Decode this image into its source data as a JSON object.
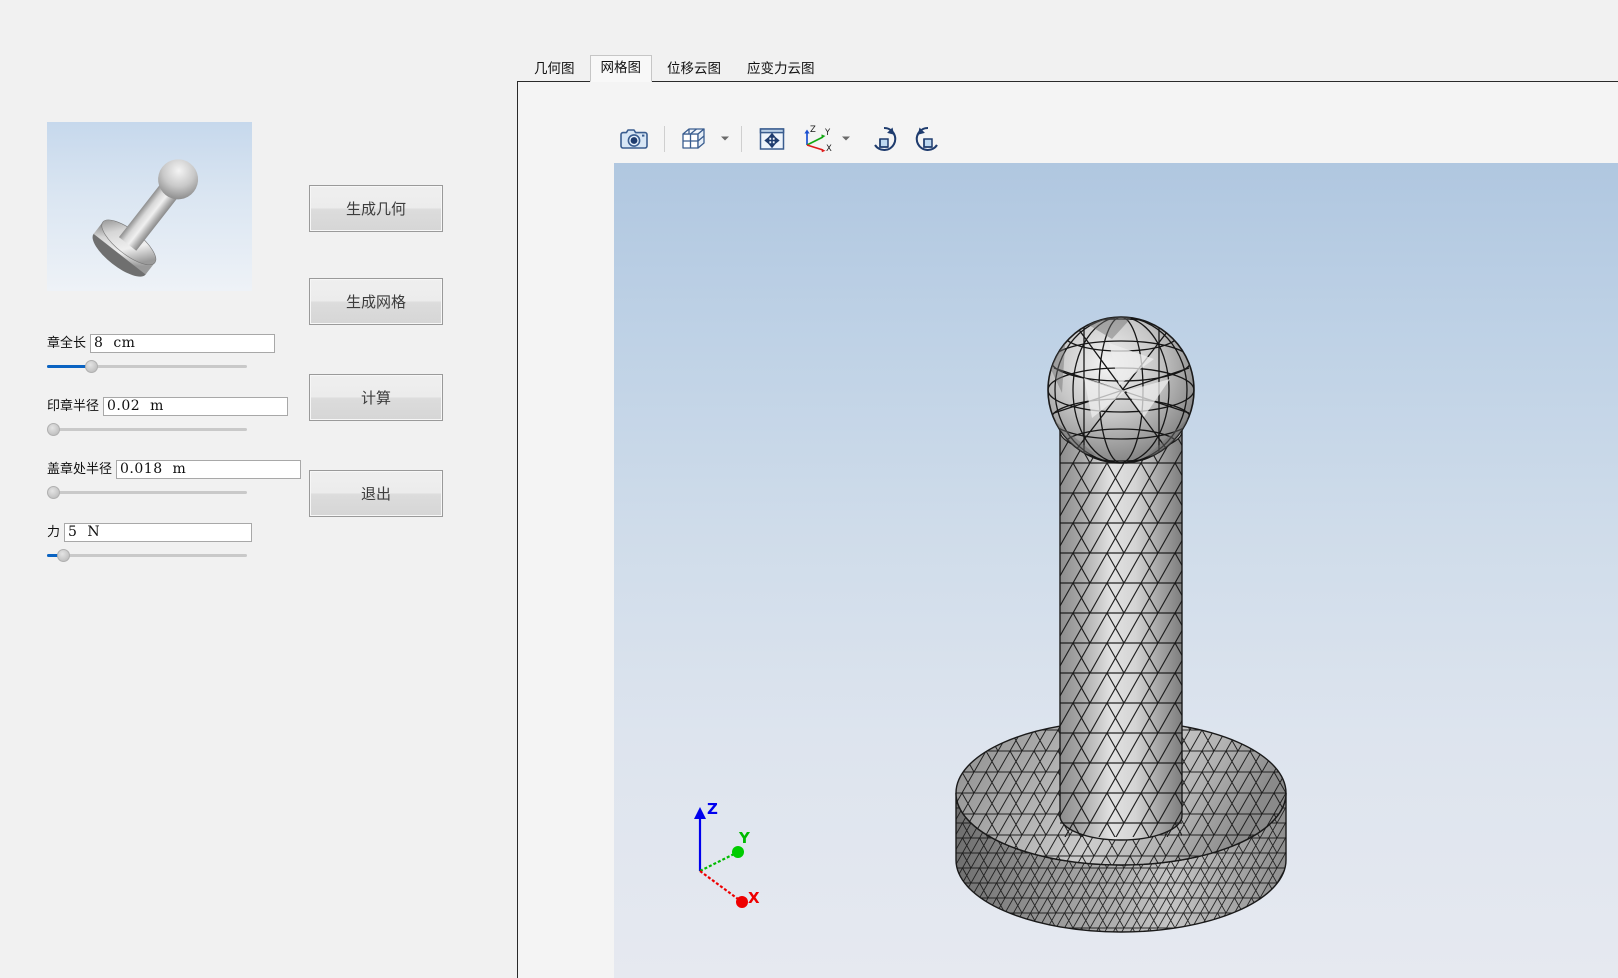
{
  "app": {
    "background_color": "#f1f1f1"
  },
  "left_panel": {
    "preview": {
      "name": "stamp-preview-render",
      "alt": "3D rendered stamp preview"
    },
    "parameters": [
      {
        "label": "章全长",
        "value": "8  cm",
        "slider_pct": 22,
        "slider_filled": true
      },
      {
        "label": "印章半径",
        "value": "0.02  m",
        "slider_pct": 2,
        "slider_filled": false
      },
      {
        "label": "盖章处半径",
        "value": "0.018  m",
        "slider_pct": 2,
        "slider_filled": false
      },
      {
        "label": "力",
        "value": "5  N",
        "slider_pct": 8,
        "slider_filled": true
      }
    ],
    "buttons": [
      {
        "label": "生成几何"
      },
      {
        "label": "生成网格"
      },
      {
        "label": "计算"
      },
      {
        "label": "退出"
      }
    ]
  },
  "tabs": [
    {
      "label": "几何图",
      "active": false
    },
    {
      "label": "网格图",
      "active": true
    },
    {
      "label": "位移云图",
      "active": false
    },
    {
      "label": "应变力云图",
      "active": false
    }
  ],
  "viewer": {
    "toolbar": [
      {
        "name": "screenshot-icon",
        "tooltip": "截图"
      },
      {
        "name": "view-cube-icon",
        "tooltip": "视图"
      },
      {
        "name": "fit-view-icon",
        "tooltip": "适应视图"
      },
      {
        "name": "axis-triad-icon",
        "tooltip": "坐标轴"
      },
      {
        "name": "rotate-cw-icon",
        "tooltip": "顺时针旋转"
      },
      {
        "name": "rotate-ccw-icon",
        "tooltip": "逆时针旋转"
      }
    ],
    "axis_triad": {
      "z_label": "Z",
      "z_color": "#0000ee",
      "y_label": "Y",
      "y_color": "#00cc00",
      "x_label": "X",
      "x_color": "#ee0000"
    },
    "background_top": "#b0c7e0",
    "background_bottom": "#e6e9f0",
    "model": {
      "name": "stamp-mesh",
      "description": "三角网格：球形手柄 + 圆柱杆 + 圆盘底座",
      "mesh_edge_color": "#1a1a1a",
      "face_light": "#ededed",
      "face_mid": "#b9b9b9",
      "face_dark": "#8a8a8a"
    }
  }
}
